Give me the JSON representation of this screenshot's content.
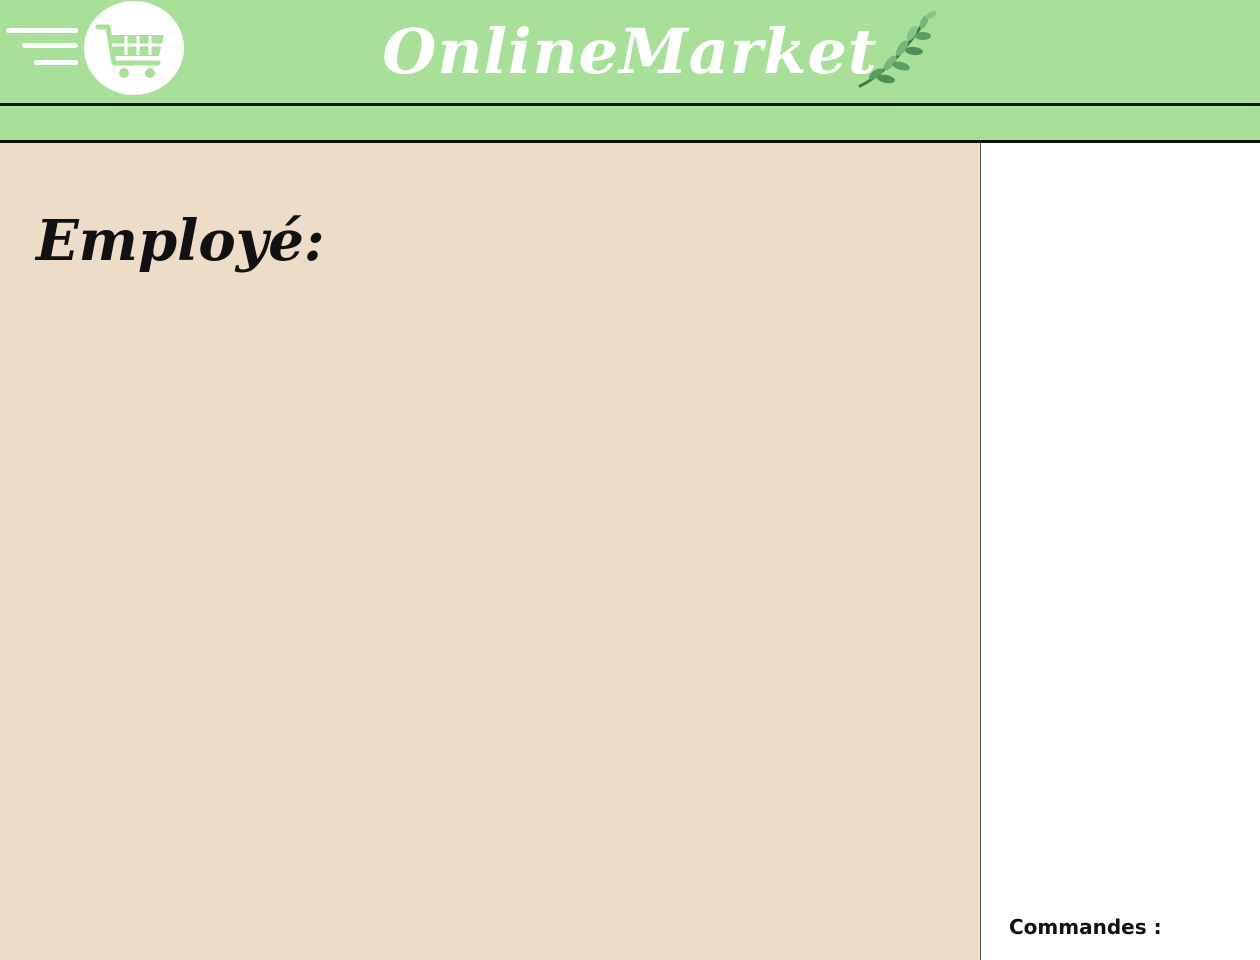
{
  "header": {
    "brand": "OnlineMarket",
    "menu_icon": "hamburger-menu-icon",
    "logo_icon": "shopping-cart-icon",
    "decoration_icon": "leaf-branch-icon"
  },
  "main": {
    "title": "Employé:"
  },
  "sidebar": {
    "orders_label": "Commandes :"
  },
  "colors": {
    "header_bg": "#a8e09a",
    "main_bg": "#eddcc7",
    "side_bg": "#ffffff",
    "text": "#111111"
  }
}
